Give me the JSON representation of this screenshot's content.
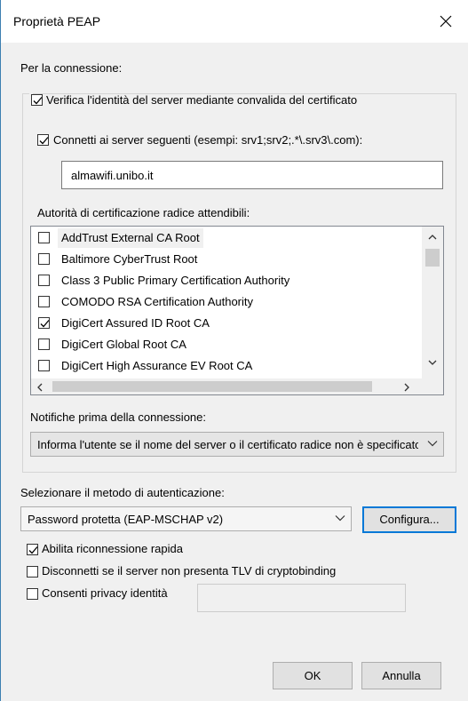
{
  "window": {
    "title": "Proprietà PEAP"
  },
  "connection": {
    "header": "Per la connessione:",
    "verify_server_label": "Verifica l'identità del server mediante convalida del certificato",
    "verify_server_checked": true,
    "connect_servers_label": "Connetti ai server seguenti (esempi: srv1;srv2;.*\\.srv3\\.com):",
    "connect_servers_checked": true,
    "server_value": "almawifi.unibo.it",
    "ca_header": "Autorità di certificazione radice attendibili:",
    "ca_list": [
      {
        "label": "AddTrust External CA Root",
        "checked": false
      },
      {
        "label": "Baltimore CyberTrust Root",
        "checked": false
      },
      {
        "label": "Class 3 Public Primary Certification Authority",
        "checked": false
      },
      {
        "label": "COMODO RSA Certification Authority",
        "checked": false
      },
      {
        "label": "DigiCert Assured ID Root CA",
        "checked": true
      },
      {
        "label": "DigiCert Global Root CA",
        "checked": false
      },
      {
        "label": "DigiCert High Assurance EV Root CA",
        "checked": false
      }
    ],
    "notify_header": "Notifiche prima della connessione:",
    "notify_value": "Informa l'utente se il nome del server o il certificato radice non è specificato"
  },
  "auth": {
    "header": "Selezionare il metodo di autenticazione:",
    "method_value": "Password protetta (EAP-MSCHAP v2)",
    "configure_label": "Configura...",
    "fast_reconnect_label": "Abilita riconnessione rapida",
    "fast_reconnect_checked": true,
    "disconnect_tlv_label": "Disconnetti se il server non presenta TLV di cryptobinding",
    "disconnect_tlv_checked": false,
    "identity_privacy_label": "Consenti privacy identità",
    "identity_privacy_checked": false,
    "identity_privacy_value": ""
  },
  "buttons": {
    "ok_label": "OK",
    "cancel_label": "Annulla"
  },
  "colors": {
    "accent": "#0078d7",
    "window_bg": "#f0f0f0",
    "border": "#3c7fb1"
  },
  "icons": {
    "close": "close-icon",
    "check": "check-icon",
    "dropdown": "chevron-down-icon"
  }
}
